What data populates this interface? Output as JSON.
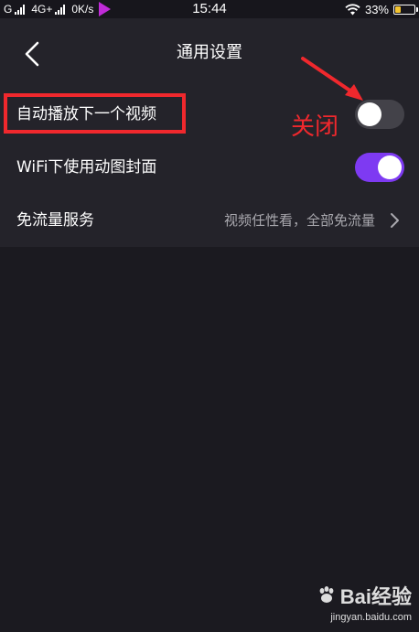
{
  "status_bar": {
    "carrier_1": "G",
    "carrier_2": "4G+",
    "net_speed": "0K/s",
    "time": "15:44",
    "battery": "33%",
    "battery_level": 0.33
  },
  "nav": {
    "title": "通用设置",
    "back_icon": "chevron-left-icon"
  },
  "settings": {
    "autoplay": {
      "label": "自动播放下一个视频",
      "enabled": false
    },
    "wifi_gif_cover": {
      "label": "WiFi下使用动图封面",
      "enabled": true
    },
    "data_free": {
      "label": "免流量服务",
      "value": "视频任性看，全部免流量",
      "icon": "chevron-right-icon"
    }
  },
  "annotation": {
    "text": "关闭",
    "color": "#f0282d"
  },
  "watermark": {
    "brand": "Bai经验",
    "url": "jingyan.baidu.com"
  },
  "colors": {
    "background": "#1b1a20",
    "panel": "#24232a",
    "toggle_on": "#7e3af2",
    "toggle_off": "#434249",
    "battery": "#f4c430"
  }
}
